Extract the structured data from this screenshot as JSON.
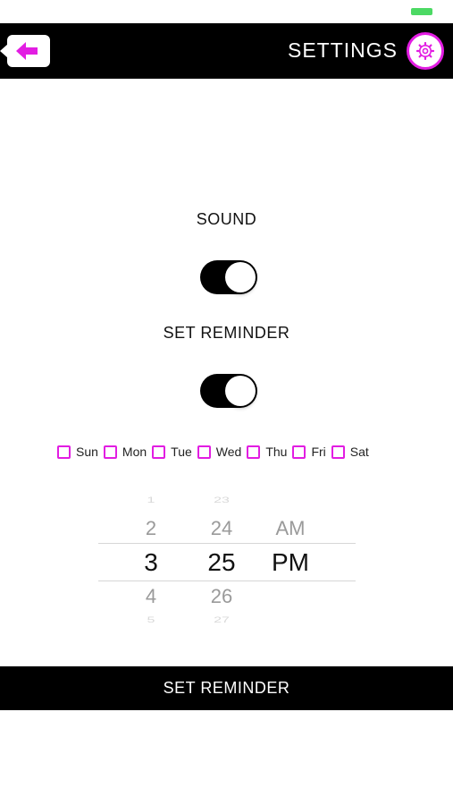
{
  "colors": {
    "accent": "#e21de2",
    "header_bg": "#000000",
    "battery": "#4cd964",
    "toggle_on": "#000000"
  },
  "status_bar": {
    "battery_icon": "battery-icon"
  },
  "header": {
    "back_icon": "arrow-left-icon",
    "title": "SETTINGS",
    "settings_icon": "gear-icon"
  },
  "sound": {
    "label": "SOUND",
    "enabled": true
  },
  "reminder": {
    "label": "SET REMINDER",
    "enabled": true
  },
  "days": [
    {
      "label": "Sun",
      "checked": false
    },
    {
      "label": "Mon",
      "checked": false
    },
    {
      "label": "Tue",
      "checked": false
    },
    {
      "label": "Wed",
      "checked": false
    },
    {
      "label": "Thu",
      "checked": false
    },
    {
      "label": "Fri",
      "checked": false
    },
    {
      "label": "Sat",
      "checked": false
    }
  ],
  "time_picker": {
    "hours": [
      "1",
      "2",
      "3",
      "4",
      "5"
    ],
    "minutes": [
      "23",
      "24",
      "25",
      "26",
      "27"
    ],
    "ampm": [
      "AM",
      "PM"
    ],
    "selected": {
      "hour": "3",
      "minute": "25",
      "ampm": "PM"
    }
  },
  "footer": {
    "button_label": "SET REMINDER"
  }
}
